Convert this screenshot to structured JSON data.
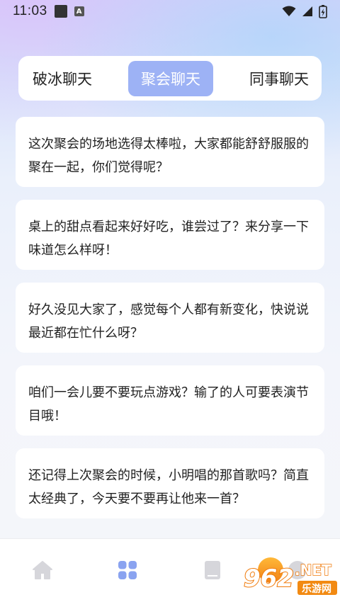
{
  "status": {
    "time": "11:03",
    "notif_letter": "A"
  },
  "tabs": [
    {
      "label": "破冰聊天",
      "active": false
    },
    {
      "label": "聚会聊天",
      "active": true
    },
    {
      "label": "同事聊天",
      "active": false
    }
  ],
  "topics": [
    {
      "text": "这次聚会的场地选得太棒啦，大家都能舒舒服服的聚在一起，你们觉得呢？"
    },
    {
      "text": "桌上的甜点看起来好好吃，谁尝过了？来分享一下味道怎么样呀！"
    },
    {
      "text": "好久没见大家了，感觉每个人都有新变化，快说说最近都在忙什么呀？"
    },
    {
      "text": "咱们一会儿要不要玩点游戏？输了的人可要表演节目哦！"
    },
    {
      "text": "还记得上次聚会的时候，小明唱的那首歌吗？简直太经典了，今天要不要再让他来一首？"
    }
  ],
  "watermark": {
    "number": "962",
    "suffix": ".NET",
    "sub": "乐游网"
  },
  "colors": {
    "tab_active_bg": "#9db2f5",
    "nav_active": "#8aa3f0",
    "nav_inactive": "#d6d6db"
  }
}
